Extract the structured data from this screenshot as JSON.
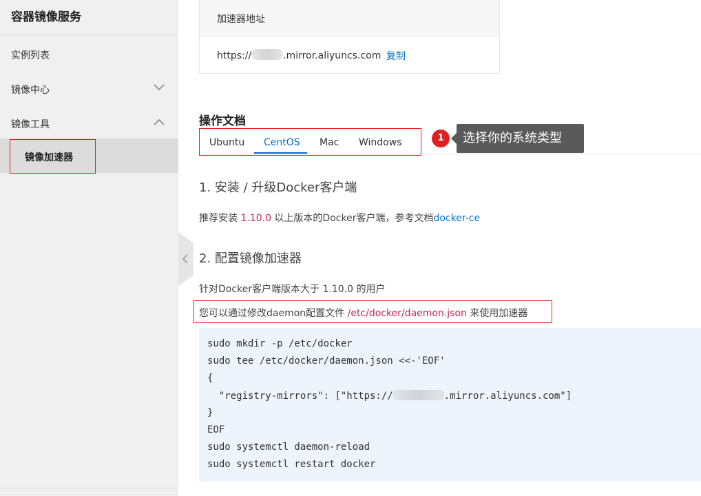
{
  "sidebar": {
    "title": "容器镜像服务",
    "items": [
      {
        "label": "实例列表"
      },
      {
        "label": "镜像中心"
      },
      {
        "label": "镜像工具"
      },
      {
        "label": "镜像加速器"
      }
    ]
  },
  "accelerator": {
    "header": "加速器地址",
    "url_prefix": "https://",
    "url_suffix": ".mirror.aliyuncs.com",
    "copy_label": "复制"
  },
  "docs": {
    "title": "操作文档",
    "tabs": [
      {
        "label": "Ubuntu"
      },
      {
        "label": "CentOS"
      },
      {
        "label": "Mac"
      },
      {
        "label": "Windows"
      }
    ],
    "active_tab": "CentOS",
    "annotation_number": "1",
    "annotation_text": "选择你的系统类型",
    "section1_title": "1. 安装 / 升级Docker客户端",
    "section1_pre": "推荐安装 ",
    "section1_version": "1.10.0",
    "section1_mid": " 以上版本的Docker客户端，参考文档",
    "section1_link": "docker-ce",
    "section2_title": "2. 配置镜像加速器",
    "section2_line1": "针对Docker客户端版本大于 1.10.0 的用户",
    "section2_pre": "您可以通过修改daemon配置文件 ",
    "section2_path": "/etc/docker/daemon.json",
    "section2_post": " 来使用加速器",
    "code": {
      "l1": "sudo mkdir -p /etc/docker",
      "l2": "sudo tee /etc/docker/daemon.json <<-'EOF'",
      "l3": "{",
      "l4_pre": "  \"registry-mirrors\": [\"https://",
      "l4_post": ".mirror.aliyuncs.com\"]",
      "l5": "}",
      "l6": "EOF",
      "l7": "sudo systemctl daemon-reload",
      "l8": "sudo systemctl restart docker"
    }
  },
  "colors": {
    "accent": "#0070cc",
    "highlight_box": "#e02020",
    "code_bg": "#eef4fb",
    "sidebar_bg": "#f0f0f0"
  }
}
